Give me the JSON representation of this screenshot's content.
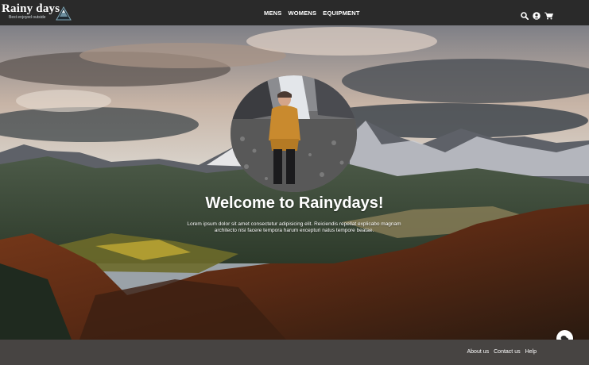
{
  "brand": {
    "title": "Rainy days",
    "tagline": "Best enjoyed outside"
  },
  "nav": {
    "items": [
      {
        "label": "MENS"
      },
      {
        "label": "WOMENS"
      },
      {
        "label": "EQUIPMENT"
      }
    ]
  },
  "header_icons": [
    "search-icon",
    "user-icon",
    "cart-icon"
  ],
  "hero": {
    "title": "Welcome to Rainydays!",
    "text": "Lorem ipsum dolor sit amet consectetur adipisicing elit. Reiciendis repellat explicabo magnam architecto nisi facere tempora harum excepturi natus tempore beatae."
  },
  "footer": {
    "links": [
      {
        "label": "About us"
      },
      {
        "label": "Contact us"
      },
      {
        "label": "Help"
      }
    ]
  },
  "colors": {
    "header_bg": "#2a2a2a",
    "footer_bg": "#474442",
    "text": "#ffffff"
  }
}
